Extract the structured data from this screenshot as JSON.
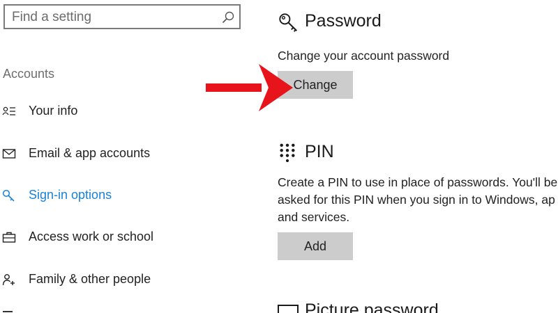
{
  "search": {
    "placeholder": "Find a setting",
    "icon": "search-icon"
  },
  "sidebar": {
    "heading": "Accounts",
    "items": [
      {
        "label": "Your info",
        "icon": "person-card-icon"
      },
      {
        "label": "Email & app accounts",
        "icon": "mail-icon"
      },
      {
        "label": "Sign-in options",
        "icon": "key-icon",
        "active": true
      },
      {
        "label": "Access work or school",
        "icon": "briefcase-icon"
      },
      {
        "label": "Family & other people",
        "icon": "person-add-icon"
      }
    ]
  },
  "password": {
    "title": "Password",
    "icon": "key-icon",
    "description": "Change your account password",
    "button": "Change"
  },
  "pin": {
    "title": "PIN",
    "icon": "keypad-icon",
    "description_lines": [
      "Create a PIN to use in place of passwords. You'll be",
      "asked for this PIN when you sign in to Windows, ap",
      "and services."
    ],
    "button": "Add"
  },
  "picture_password": {
    "title": "Picture password",
    "icon": "picture-icon"
  },
  "colors": {
    "accent": "#1a82d6",
    "button_bg": "#cccccc",
    "arrow": "#e8141b"
  }
}
